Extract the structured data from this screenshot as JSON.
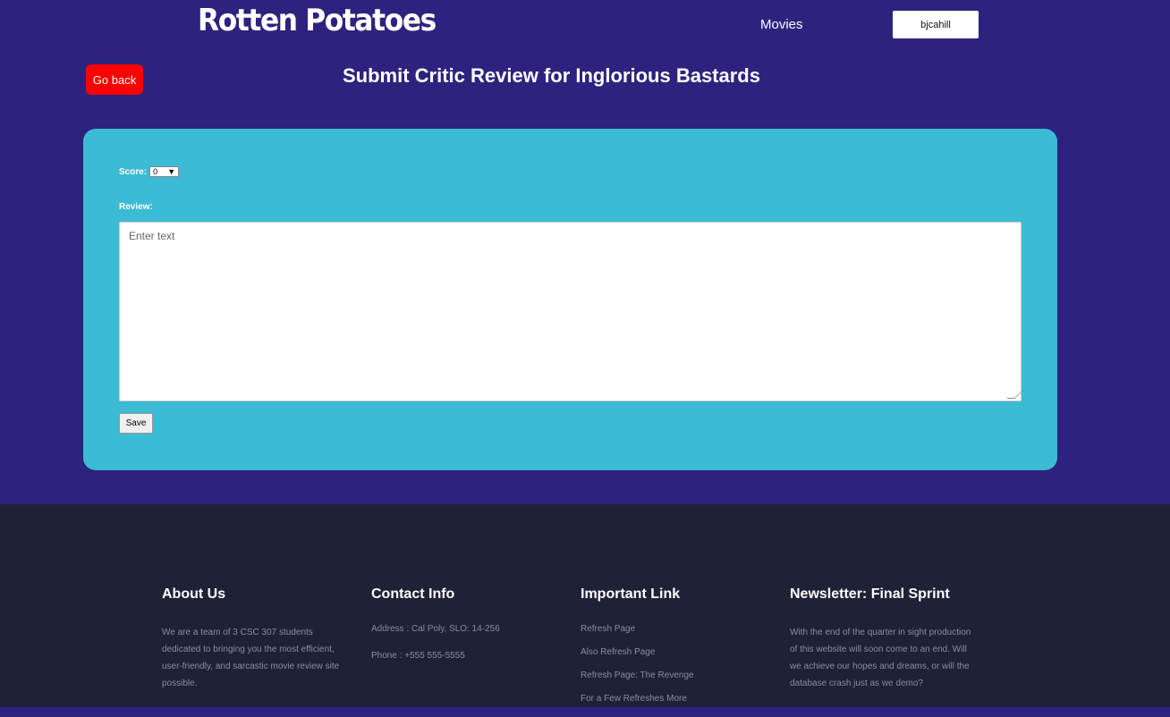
{
  "header": {
    "logo": "Rotten Potatoes",
    "nav_movies": "Movies",
    "user": "bjcahill"
  },
  "page": {
    "go_back": "Go back",
    "title": "Submit Critic Review for Inglorious Bastards"
  },
  "form": {
    "score_label": "Score:",
    "score_value": "0",
    "review_label": "Review:",
    "review_placeholder": "Enter text",
    "save_label": "Save"
  },
  "footer": {
    "about": {
      "heading": "About Us",
      "text": "We are a team of 3 CSC 307 students dedicated to bringing you the most efficient, user-friendly, and sarcastic movie review site possible."
    },
    "contact": {
      "heading": "Contact Info",
      "address": "Address : Cal Poly, SLO: 14-256",
      "phone": "Phone : +555 555-5555"
    },
    "links": {
      "heading": "Important Link",
      "items": [
        "Refresh Page",
        "Also Refresh Page",
        "Refresh Page: The Revenge",
        "For a Few Refreshes More"
      ]
    },
    "newsletter": {
      "heading": "Newsletter: Final Sprint",
      "text": "With the end of the quarter in sight production of this website will soon come to an end. Will we achieve our hopes and dreams, or will the database crash just as we demo?"
    }
  },
  "colors": {
    "background": "#2d237e",
    "card": "#3bbcd4",
    "go_back": "#ff0000",
    "footer": "#1f2237"
  }
}
